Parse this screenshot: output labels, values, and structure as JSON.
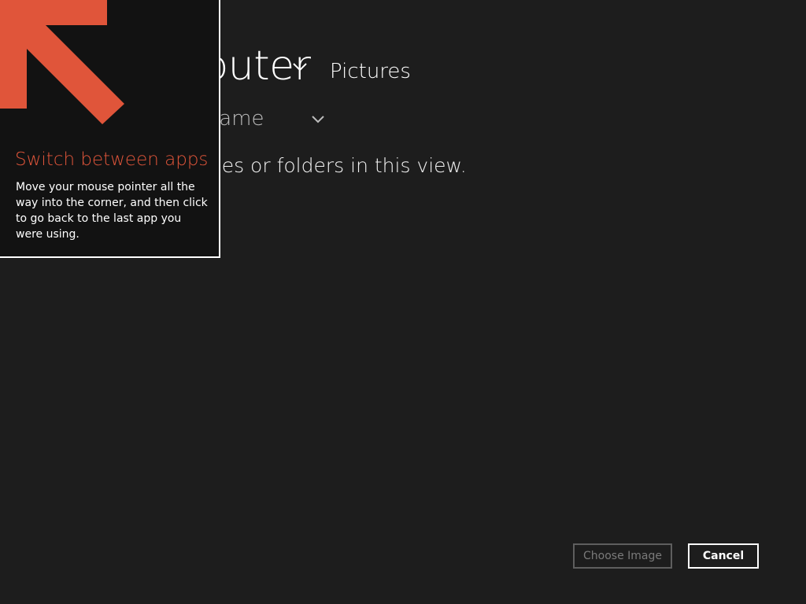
{
  "picker": {
    "location_title": "Computer",
    "location_sub": "Pictures",
    "sort_label": "Sort by name",
    "empty_message": "There are no files or folders in this view."
  },
  "tip": {
    "title": "Switch between apps",
    "body": "Move your mouse pointer all the way into the corner, and then click to go back to the last app you were using.",
    "accent_color": "#e0553a",
    "arrow_icon": "arrow-up-left-icon"
  },
  "buttons": {
    "choose_label": "Choose Image",
    "cancel_label": "Cancel"
  },
  "icons": {
    "location_chevron": "chevron-down-icon",
    "sort_chevron": "chevron-down-icon"
  }
}
